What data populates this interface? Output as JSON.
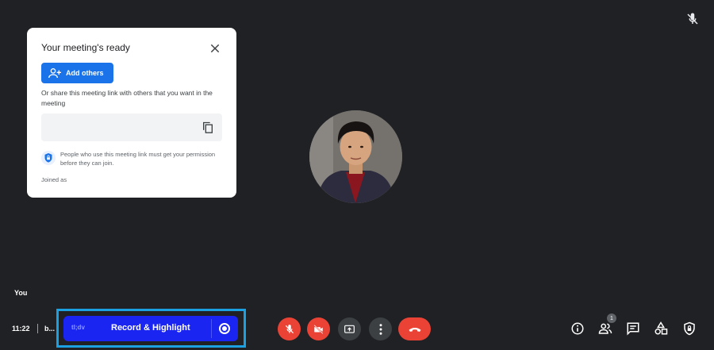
{
  "card": {
    "title": "Your meeting's ready",
    "add_others_label": "Add others",
    "share_text": "Or share this meeting link with others that you want in the meeting",
    "link_value": "",
    "permission_text": "People who use this meeting link must get your permission before they can join.",
    "joined_as": "Joined as"
  },
  "tile": {
    "name": "You"
  },
  "bottom": {
    "time": "11:22",
    "meeting_code": "b..."
  },
  "tldv": {
    "logo": "tl;dv",
    "label": "Record & Highlight"
  },
  "people_badge": "1",
  "colors": {
    "background": "#202124",
    "accent": "#1a73e8",
    "end_call": "#ea4335",
    "tldv": "#1a25f2",
    "highlight_frame": "#1ba1e2"
  }
}
